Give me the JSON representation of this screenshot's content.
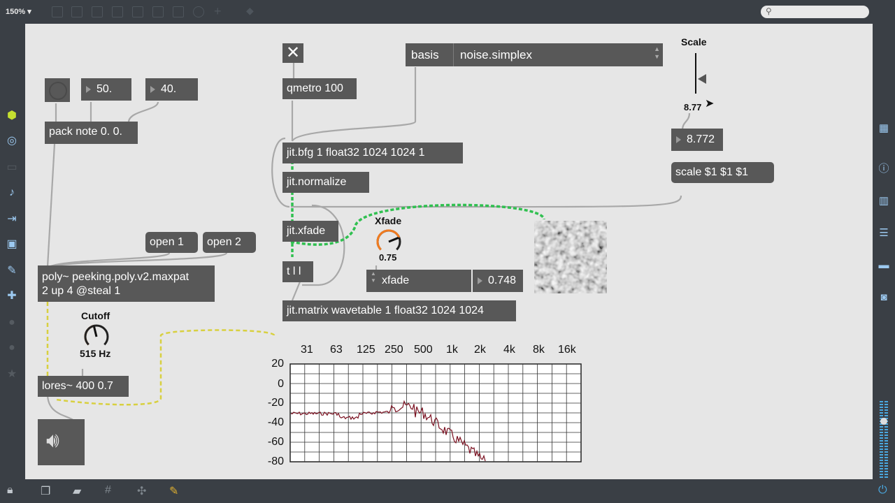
{
  "toolbar": {
    "zoom": "150%"
  },
  "patch": {
    "objects": {
      "pack": "pack note 0. 0.",
      "qmetro": "qmetro 100",
      "bfg": "jit.bfg 1 float32 1024 1024 1",
      "normalize": "jit.normalize",
      "xfade_obj": "jit.xfade",
      "trigger": "t l l",
      "matrix": "jit.matrix wavetable 1 float32 1024 1024",
      "poly_line1": "poly~ peeking.poly.v2.maxpat",
      "poly_line2": "2 up 4 @steal 1",
      "lores": "lores~ 400 0.7"
    },
    "numbers": {
      "n1": "50.",
      "n2": "40.",
      "scale_num": "8.772",
      "xfade_num": "0.748"
    },
    "messages": {
      "open1": "open 1",
      "open2": "open 2",
      "scale_msg": "scale $1 $1 $1"
    },
    "umenu": {
      "left": "basis",
      "right": "noise.simplex"
    },
    "live_menu": {
      "value": "xfade"
    },
    "dials": {
      "xfade": {
        "label": "Xfade",
        "value": "0.75",
        "fraction": 0.75
      },
      "cutoff": {
        "label": "Cutoff",
        "value": "515 Hz",
        "fraction": 0.45
      }
    },
    "slider": {
      "label": "Scale",
      "value": "8.77"
    },
    "colors": {
      "accent_orange": "#f07b20",
      "patch_green": "#30c050",
      "patch_yellow": "#d8d040",
      "box_gray": "#585858"
    }
  },
  "spectrum": {
    "freq_labels": [
      "31",
      "63",
      "125",
      "250",
      "500",
      "1k",
      "2k",
      "4k",
      "8k",
      "16k"
    ],
    "db_labels": [
      "20",
      "0",
      "-20",
      "-40",
      "-60",
      "-80"
    ]
  }
}
